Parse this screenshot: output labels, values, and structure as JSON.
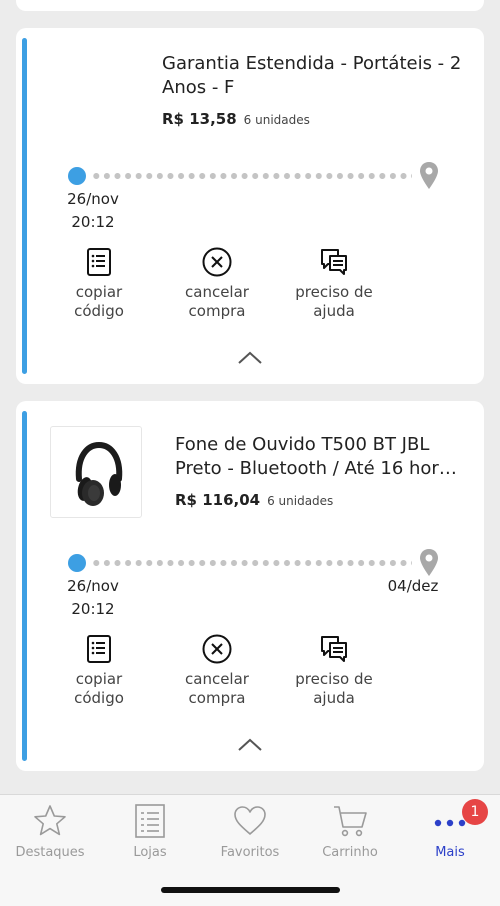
{
  "orders": [
    {
      "title_lines": [
        "Garantia Estendida - Portáteis - 2",
        "Anos - F"
      ],
      "price": "R$ 13,58",
      "units": "6 unidades",
      "start_date": "26/nov",
      "start_time": "20:12",
      "end_date": "",
      "actions": {
        "copy_lines": [
          "copiar",
          "código"
        ],
        "cancel_lines": [
          "cancelar",
          "compra"
        ],
        "help_lines": [
          "preciso de",
          "ajuda"
        ]
      }
    },
    {
      "title_lines": [
        "Fone de Ouvido T500 BT JBL",
        "Preto - Bluetooth / Até 16 hora..."
      ],
      "price": "R$ 116,04",
      "units": "6 unidades",
      "start_date": "26/nov",
      "start_time": "20:12",
      "end_date": "04/dez",
      "actions": {
        "copy_lines": [
          "copiar",
          "código"
        ],
        "cancel_lines": [
          "cancelar",
          "compra"
        ],
        "help_lines": [
          "preciso de",
          "ajuda"
        ]
      }
    }
  ],
  "tabbar": {
    "tabs": [
      {
        "label": "Destaques",
        "icon": "star-icon",
        "active": false
      },
      {
        "label": "Lojas",
        "icon": "list-icon",
        "active": false
      },
      {
        "label": "Favoritos",
        "icon": "heart-icon",
        "active": false
      },
      {
        "label": "Carrinho",
        "icon": "cart-icon",
        "active": false
      },
      {
        "label": "Mais",
        "icon": "more-icon",
        "active": true
      }
    ],
    "badge": "1"
  },
  "colors": {
    "accent": "#3d9fe3",
    "active_tab": "#2c40c9",
    "badge": "#e64545"
  }
}
